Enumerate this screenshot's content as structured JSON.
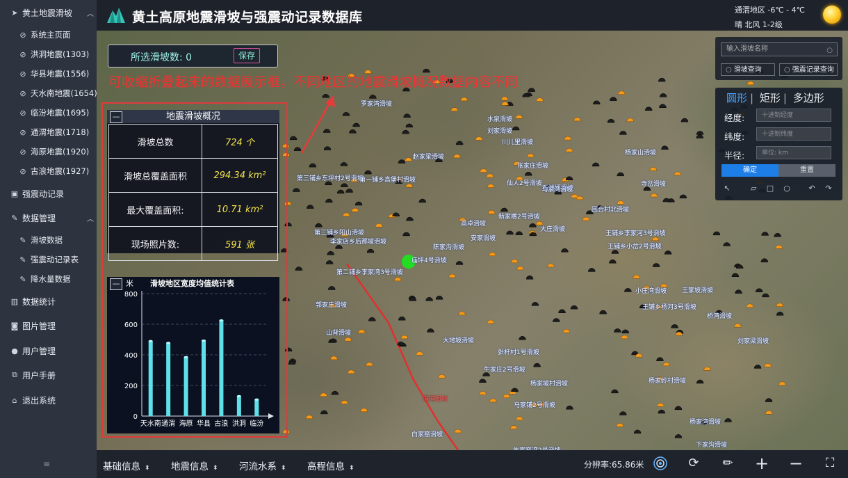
{
  "app": {
    "title": "黄土高原地震滑坡与强震动记录数据库"
  },
  "weather": {
    "location_temp": "通渭地区  -6℃ - 4℃",
    "condition": "晴    北风 1-2级"
  },
  "sidebar": {
    "group_title": "黄土地震滑坡",
    "sub_items": [
      {
        "label": "系统主页面"
      },
      {
        "label": "洪洞地震(1303)"
      },
      {
        "label": "华县地震(1556)"
      },
      {
        "label": "天水南地震(1654)"
      },
      {
        "label": "临汾地震(1695)"
      },
      {
        "label": "通渭地震(1718)"
      },
      {
        "label": "海原地震(1920)"
      },
      {
        "label": "古浪地震(1927)"
      }
    ],
    "strong_motion": "强震动记录",
    "data_mgmt": "数据管理",
    "data_mgmt_items": [
      {
        "label": "滑坡数据"
      },
      {
        "label": "强震动记录表"
      },
      {
        "label": "降水量数据"
      }
    ],
    "stats": "数据统计",
    "images": "图片管理",
    "users": "用户管理",
    "manual": "用户手册",
    "logout": "退出系统",
    "bottom_glyph": "≡"
  },
  "selection": {
    "label": "所选滑坡数: ",
    "count": "0",
    "save": "保存"
  },
  "annotation": "可收缩折叠起来的数据展示框，不同地区的地震滑坡概况数据内容不同",
  "overview": {
    "collapse": "—",
    "title": "地震滑坡概况",
    "rows": [
      {
        "key": "滑坡总数",
        "value": "724 个"
      },
      {
        "key": "滑坡总覆盖面积",
        "value": "294.34 km²"
      },
      {
        "key": "最大覆盖面积:",
        "value": "10.71 km²"
      },
      {
        "key": "现场照片数:",
        "value": "591 张"
      }
    ]
  },
  "chart_panel": {
    "collapse": "—"
  },
  "chart_data": {
    "type": "bar",
    "title": "滑坡地区宽度均值统计表",
    "ylabel": "米",
    "categories": [
      "天水南",
      "通渭",
      "海原",
      "华县",
      "古浪",
      "洪洞",
      "临汾"
    ],
    "values": [
      490,
      478,
      385,
      493,
      625,
      130,
      108
    ],
    "ylim": [
      0,
      800
    ],
    "yticks": [
      0,
      200,
      400,
      600,
      800
    ],
    "grid": true,
    "bar_color": "#5fe0e8"
  },
  "search": {
    "placeholder": "输入滑坡名称",
    "landslide_query": "滑坡查询",
    "record_query": "强震记录查询"
  },
  "shape_query": {
    "tab_circle": "圆形",
    "tab_rect": "矩形",
    "tab_poly": "多边形",
    "lon_label": "经度:",
    "lon_placeholder": "十进制经度",
    "lat_label": "纬度:",
    "lat_placeholder": "十进制纬度",
    "radius_label": "半径:",
    "radius_placeholder": "单位: km",
    "confirm": "确定",
    "reset": "重置"
  },
  "bottom": {
    "menus": [
      {
        "label": "基础信息"
      },
      {
        "label": "地震信息"
      },
      {
        "label": "河流水系"
      },
      {
        "label": "高程信息"
      }
    ],
    "resolution": "分辨率:65.86米"
  },
  "map": {
    "labels": [
      {
        "text": "罗家湾滑坡"
      },
      {
        "text": "水泉滑坡"
      },
      {
        "text": "刘家滑坡"
      },
      {
        "text": "川儿里滑坡"
      },
      {
        "text": "杨家山滑坡"
      },
      {
        "text": "张家庄滑坡"
      },
      {
        "text": "寺岔滑坡"
      },
      {
        "text": "赵家梁滑坡"
      },
      {
        "text": "第三铺乡东坪村2号滑坡"
      },
      {
        "text": "第一铺乡高堡村滑坡"
      },
      {
        "text": "仙人2号滑坡"
      },
      {
        "text": "石滩坪滑坡"
      },
      {
        "text": "马家湾滑坡"
      },
      {
        "text": "回合村北滑坡"
      },
      {
        "text": "新家嘴2号滑坡"
      },
      {
        "text": "大庄滑坡"
      },
      {
        "text": "王铺乡李家河3号滑坡"
      },
      {
        "text": "王铺乡小岔2号滑坡"
      },
      {
        "text": "第三铺乡阳山滑坡"
      },
      {
        "text": "安家滑坡"
      },
      {
        "text": "高卓滑坡"
      },
      {
        "text": "李家店乡后那坡滑坡"
      },
      {
        "text": "庙坪4号滑坡"
      },
      {
        "text": "第二铺乡李家湾3号滑坡"
      },
      {
        "text": "陈家沟滑坡"
      },
      {
        "text": "王铺乡杨河3号滑坡"
      },
      {
        "text": "郭家庄滑坡"
      },
      {
        "text": "小庄湾滑坡"
      },
      {
        "text": "王家坡滑坡"
      },
      {
        "text": "桥湾滑坡"
      },
      {
        "text": "山背滑坡"
      },
      {
        "text": "大地坡滑坡"
      },
      {
        "text": "刘家梁滑坡"
      },
      {
        "text": "张杆村1号滑坡"
      },
      {
        "text": "杨家岭村滑坡"
      },
      {
        "text": "牛家庄2号滑坡"
      },
      {
        "text": "杨家坡村滑坡"
      },
      {
        "text": "马家铺2号滑坡"
      },
      {
        "text": "白家窑滑坡"
      },
      {
        "text": "朱家窑湾2号滑坡"
      },
      {
        "text": "下家沟滑坡"
      },
      {
        "text": "杨家湾滑坡"
      },
      {
        "text": "满湾滑坡",
        "red": true
      }
    ]
  }
}
